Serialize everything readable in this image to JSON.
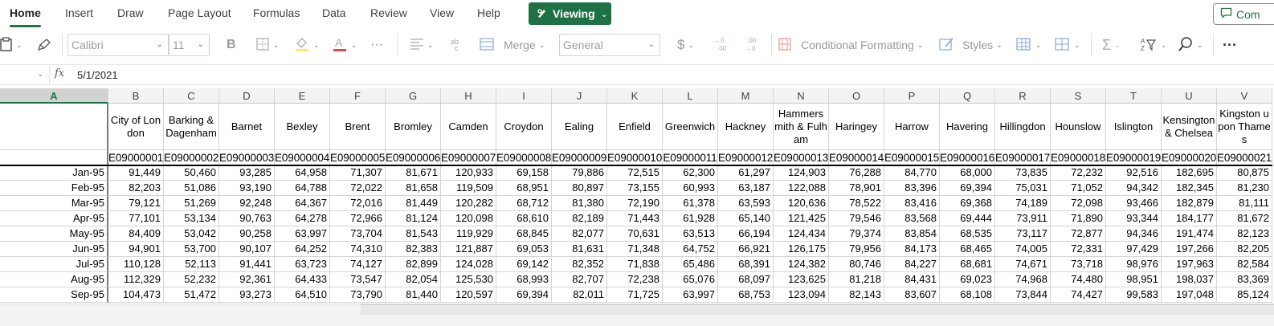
{
  "tabs": [
    "Home",
    "Insert",
    "Draw",
    "Page Layout",
    "Formulas",
    "Data",
    "Review",
    "View",
    "Help"
  ],
  "viewing_label": "Viewing",
  "comments_label": "Com",
  "toolbar": {
    "font_name": "Calibri",
    "font_size": "11",
    "bold_label": "B",
    "merge_label": "Merge",
    "number_format": "General",
    "currency_symbol": "$",
    "conditional_formatting_label": "Conditional Formatting",
    "styles_label": "Styles",
    "ellipsis": "···"
  },
  "formula_bar": {
    "name_box": "",
    "fx": "fx",
    "value": "5/1/2021"
  },
  "sheet": {
    "columns": [
      "A",
      "B",
      "C",
      "D",
      "E",
      "F",
      "G",
      "H",
      "I",
      "J",
      "K",
      "L",
      "M",
      "N",
      "O",
      "P",
      "Q",
      "R",
      "S",
      "T",
      "U",
      "V"
    ],
    "selected_column": "A",
    "borough_names": [
      "",
      "City of London",
      "Barking & Dagenham",
      "Barnet",
      "Bexley",
      "Brent",
      "Bromley",
      "Camden",
      "Croydon",
      "Ealing",
      "Enfield",
      "Greenwich",
      "Hackney",
      "Hammersmith & Fulham",
      "Haringey",
      "Harrow",
      "Havering",
      "Hillingdon",
      "Hounslow",
      "Islington",
      "Kensington & Chelsea",
      "Kingston upon Thames"
    ],
    "codes": [
      "",
      "E09000001",
      "E09000002",
      "E09000003",
      "E09000004",
      "E09000005",
      "E09000006",
      "E09000007",
      "E09000008",
      "E09000009",
      "E09000010",
      "E09000011",
      "E09000012",
      "E09000013",
      "E09000014",
      "E09000015",
      "E09000016",
      "E09000017",
      "E09000018",
      "E09000019",
      "E09000020",
      "E09000021"
    ],
    "rows": [
      [
        "Jan-95",
        "91,449",
        "50,460",
        "93,285",
        "64,958",
        "71,307",
        "81,671",
        "120,933",
        "69,158",
        "79,886",
        "72,515",
        "62,300",
        "61,297",
        "124,903",
        "76,288",
        "84,770",
        "68,000",
        "73,835",
        "72,232",
        "92,516",
        "182,695",
        "80,875"
      ],
      [
        "Feb-95",
        "82,203",
        "51,086",
        "93,190",
        "64,788",
        "72,022",
        "81,658",
        "119,509",
        "68,951",
        "80,897",
        "73,155",
        "60,993",
        "63,187",
        "122,088",
        "78,901",
        "83,396",
        "69,394",
        "75,031",
        "71,052",
        "94,342",
        "182,345",
        "81,230"
      ],
      [
        "Mar-95",
        "79,121",
        "51,269",
        "92,248",
        "64,367",
        "72,016",
        "81,449",
        "120,282",
        "68,712",
        "81,380",
        "72,190",
        "61,378",
        "63,593",
        "120,636",
        "78,522",
        "83,416",
        "69,368",
        "74,189",
        "72,098",
        "93,466",
        "182,879",
        "81,111"
      ],
      [
        "Apr-95",
        "77,101",
        "53,134",
        "90,763",
        "64,278",
        "72,966",
        "81,124",
        "120,098",
        "68,610",
        "82,189",
        "71,443",
        "61,928",
        "65,140",
        "121,425",
        "79,546",
        "83,568",
        "69,444",
        "73,911",
        "71,890",
        "93,344",
        "184,177",
        "81,672"
      ],
      [
        "May-95",
        "84,409",
        "53,042",
        "90,258",
        "63,997",
        "73,704",
        "81,543",
        "119,929",
        "68,845",
        "82,077",
        "70,631",
        "63,513",
        "66,194",
        "124,434",
        "79,374",
        "83,854",
        "68,535",
        "73,117",
        "72,877",
        "94,346",
        "191,474",
        "82,123"
      ],
      [
        "Jun-95",
        "94,901",
        "53,700",
        "90,107",
        "64,252",
        "74,310",
        "82,383",
        "121,887",
        "69,053",
        "81,631",
        "71,348",
        "64,752",
        "66,921",
        "126,175",
        "79,956",
        "84,173",
        "68,465",
        "74,005",
        "72,331",
        "97,429",
        "197,266",
        "82,205"
      ],
      [
        "Jul-95",
        "110,128",
        "52,113",
        "91,441",
        "63,723",
        "74,127",
        "82,899",
        "124,028",
        "69,142",
        "82,352",
        "71,838",
        "65,486",
        "68,391",
        "124,382",
        "80,746",
        "84,227",
        "68,681",
        "74,671",
        "73,718",
        "98,976",
        "197,963",
        "82,584"
      ],
      [
        "Aug-95",
        "112,329",
        "52,232",
        "92,361",
        "64,433",
        "73,547",
        "82,054",
        "125,530",
        "68,993",
        "82,707",
        "72,238",
        "65,076",
        "68,097",
        "123,625",
        "81,218",
        "84,431",
        "69,023",
        "74,968",
        "74,480",
        "98,951",
        "198,037",
        "83,369"
      ],
      [
        "Sep-95",
        "104,473",
        "51,472",
        "93,273",
        "64,510",
        "73,790",
        "81,440",
        "120,597",
        "69,394",
        "82,011",
        "71,725",
        "63,997",
        "68,753",
        "123,094",
        "82,143",
        "83,607",
        "68,108",
        "73,844",
        "74,427",
        "99,583",
        "197,048",
        "85,124"
      ]
    ]
  }
}
